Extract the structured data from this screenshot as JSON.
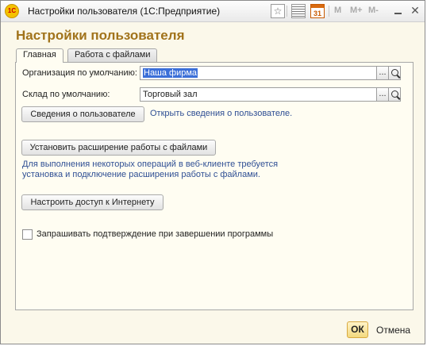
{
  "window": {
    "title": "Настройки пользователя (1С:Предприятие)"
  },
  "toolbar": {
    "calendar_day": "31",
    "m": "M",
    "m_plus": "M+",
    "m_minus": "M-"
  },
  "form": {
    "title": "Настройки пользователя"
  },
  "tabs": [
    {
      "label": "Главная",
      "active": true
    },
    {
      "label": "Работа с файлами",
      "active": false
    }
  ],
  "fields": {
    "organization": {
      "label": "Организация по умолчанию:",
      "value": "Наша фирма"
    },
    "warehouse": {
      "label": "Склад по умолчанию:",
      "value": "Торговый зал"
    }
  },
  "buttons": {
    "user_info": "Сведения о пользователе",
    "install_ext": "Установить расширение работы с файлами",
    "internet": "Настроить доступ к Интернету",
    "ok": "ОК",
    "cancel": "Отмена",
    "select": "..."
  },
  "links": {
    "user_info": "Открыть сведения о пользователе."
  },
  "info": {
    "ext_note": "Для выполнения некоторых операций в веб-клиенте требуется установка и подключение расширения работы с файлами."
  },
  "checkbox": {
    "label": "Запрашивать подтверждение при завершении программы",
    "checked": false
  }
}
